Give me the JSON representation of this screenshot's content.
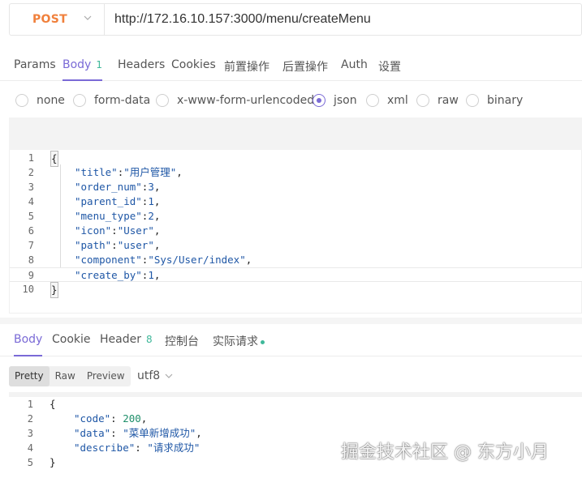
{
  "request": {
    "method": "POST",
    "url": "http://172.16.10.157:3000/menu/createMenu"
  },
  "request_tabs": [
    {
      "label": "Params"
    },
    {
      "label": "Body",
      "badge": "1"
    },
    {
      "label": "Headers"
    },
    {
      "label": "Cookies"
    },
    {
      "label": "前置操作"
    },
    {
      "label": "后置操作"
    },
    {
      "label": "Auth"
    },
    {
      "label": "设置"
    }
  ],
  "body_types": [
    {
      "label": "none",
      "checked": false
    },
    {
      "label": "form-data",
      "checked": false
    },
    {
      "label": "x-www-form-urlencoded",
      "checked": false
    },
    {
      "label": "json",
      "checked": true
    },
    {
      "label": "xml",
      "checked": false
    },
    {
      "label": "raw",
      "checked": false
    },
    {
      "label": "binary",
      "checked": false
    }
  ],
  "request_body_lines": [
    {
      "num": "1",
      "text": "{"
    },
    {
      "num": "2",
      "key": "\"title\"",
      "sep": ":",
      "value": "\"用户管理\"",
      "end": ","
    },
    {
      "num": "3",
      "key": "\"order_num\"",
      "sep": ":",
      "value": "3",
      "end": ","
    },
    {
      "num": "4",
      "key": "\"parent_id\"",
      "sep": ":",
      "value": "1",
      "end": ","
    },
    {
      "num": "5",
      "key": "\"menu_type\"",
      "sep": ":",
      "value": "2",
      "end": ","
    },
    {
      "num": "6",
      "key": "\"icon\"",
      "sep": ":",
      "value": "\"User\"",
      "end": ","
    },
    {
      "num": "7",
      "key": "\"path\"",
      "sep": ":",
      "value": "\"user\"",
      "end": ","
    },
    {
      "num": "8",
      "key": "\"component\"",
      "sep": ":",
      "value": "\"Sys/User/index\"",
      "end": ","
    },
    {
      "num": "9",
      "key": "\"create_by\"",
      "sep": ":",
      "value": "1",
      "end": ","
    },
    {
      "num": "10",
      "text": "}"
    }
  ],
  "response_tabs": [
    {
      "label": "Body"
    },
    {
      "label": "Cookie"
    },
    {
      "label": "Header",
      "badge": "8"
    },
    {
      "label": "控制台"
    },
    {
      "label": "实际请求"
    }
  ],
  "format_buttons": [
    "Pretty",
    "Raw",
    "Preview"
  ],
  "encoding": "utf8",
  "response_lines": [
    {
      "num": "1",
      "text": "{"
    },
    {
      "num": "2",
      "key": "\"code\"",
      "sep": ": ",
      "value": "200",
      "end": ","
    },
    {
      "num": "3",
      "key": "\"data\"",
      "sep": ": ",
      "value": "\"菜单新增成功\"",
      "end": ","
    },
    {
      "num": "4",
      "key": "\"describe\"",
      "sep": ": ",
      "value": "\"请求成功\"",
      "end": ""
    },
    {
      "num": "5",
      "text": "}"
    }
  ],
  "watermark": "掘金技术社区 @ 东方小月",
  "colors": {
    "accent": "#7a6ad6",
    "method": "#f0803c",
    "badge": "#3fb89a",
    "code": "#1f57a6"
  }
}
